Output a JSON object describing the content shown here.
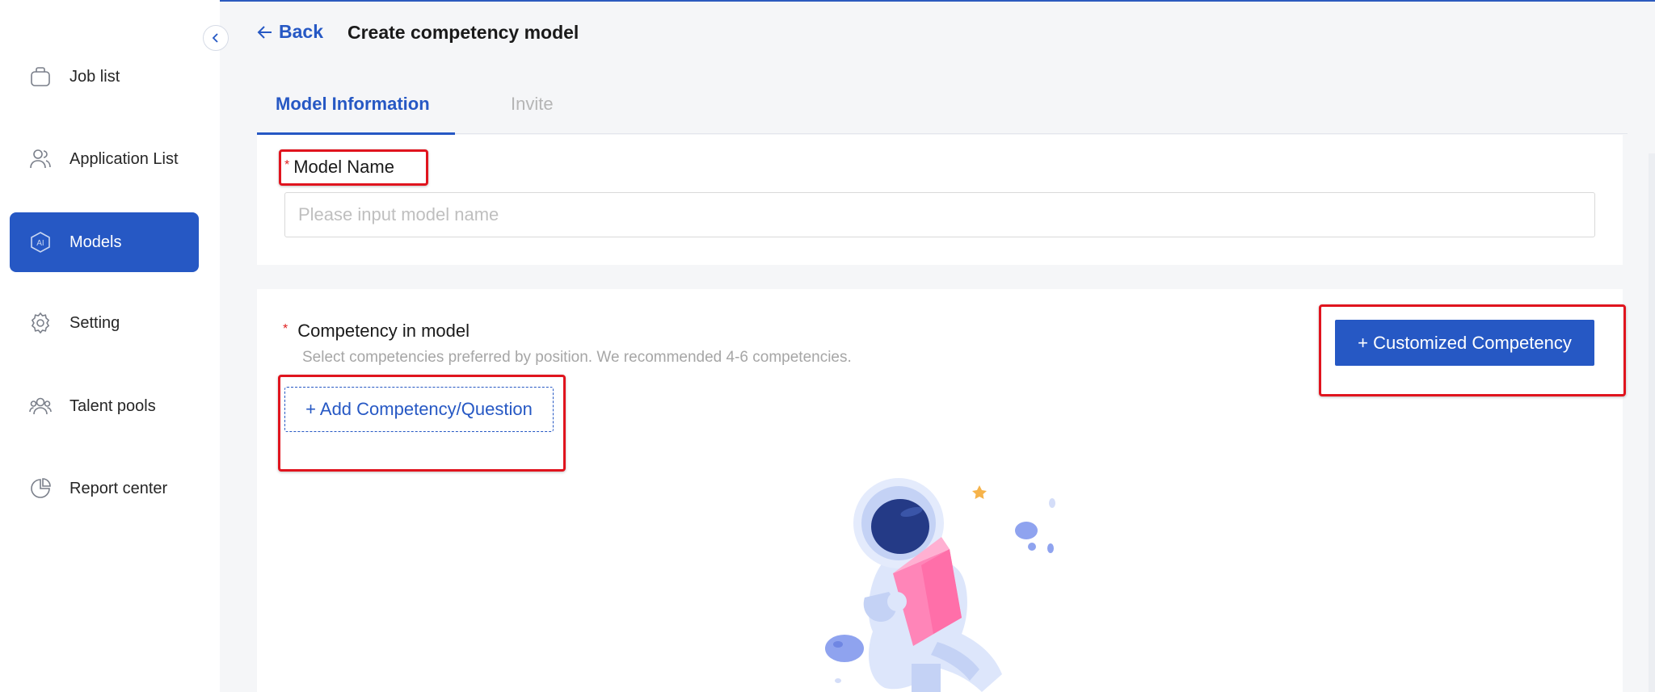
{
  "sidebar": {
    "items": [
      {
        "label": "Job list",
        "icon": "briefcase-icon",
        "active": false
      },
      {
        "label": "Application List",
        "icon": "users-icon",
        "active": false
      },
      {
        "label": "Models",
        "icon": "ai-shield-icon",
        "active": true
      },
      {
        "label": "Setting",
        "icon": "gear-icon",
        "active": false
      },
      {
        "label": "Talent pools",
        "icon": "group-icon",
        "active": false
      },
      {
        "label": "Report center",
        "icon": "pie-chart-icon",
        "active": false
      }
    ],
    "ai_badge": "AI"
  },
  "header": {
    "back_label": "Back",
    "title": "Create competency model"
  },
  "tabs": [
    {
      "label": "Model Information",
      "active": true
    },
    {
      "label": "Invite",
      "active": false
    }
  ],
  "model_info": {
    "name_label": "Model Name",
    "name_required_mark": "*",
    "name_value": "",
    "name_placeholder": "Please input model name"
  },
  "competency": {
    "label": "Competency in model",
    "required_mark": "*",
    "hint": "Select competencies preferred by position. We recommended 4-6 competencies.",
    "add_button": "+ Add Competency/Question",
    "custom_button": "+ Customized Competency"
  },
  "colors": {
    "primary": "#2658c4",
    "highlight": "#e0141e",
    "required": "#e02020"
  }
}
